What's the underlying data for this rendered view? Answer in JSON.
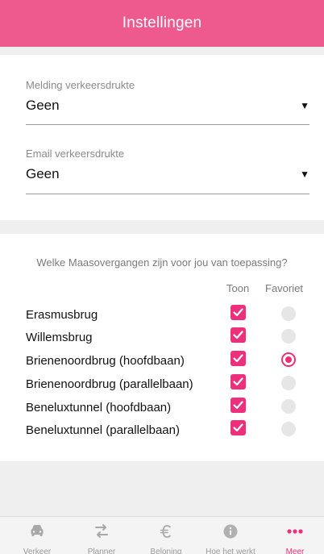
{
  "header": {
    "title": "Instellingen"
  },
  "notifications": {
    "melding": {
      "label": "Melding verkeersdrukte",
      "value": "Geen"
    },
    "email": {
      "label": "Email verkeersdrukte",
      "value": "Geen"
    }
  },
  "crossings": {
    "question": "Welke Maasovergangen zijn voor jou van toepassing?",
    "col_show": "Toon",
    "col_favorite": "Favoriet",
    "items": [
      {
        "label": "Erasmusbrug",
        "show": true,
        "favorite": false
      },
      {
        "label": "Willemsbrug",
        "show": true,
        "favorite": false
      },
      {
        "label": "Brienenoordbrug (hoofdbaan)",
        "show": true,
        "favorite": true
      },
      {
        "label": "Brienenoordbrug (parallelbaan)",
        "show": true,
        "favorite": false
      },
      {
        "label": "Beneluxtunnel (hoofdbaan)",
        "show": true,
        "favorite": false
      },
      {
        "label": "Beneluxtunnel (parallelbaan)",
        "show": true,
        "favorite": false
      }
    ]
  },
  "tabbar": {
    "tabs": [
      {
        "label": "Verkeer",
        "icon": "car-icon",
        "active": false
      },
      {
        "label": "Planner",
        "icon": "route-arrows-icon",
        "active": false
      },
      {
        "label": "Beloning",
        "icon": "euro-icon",
        "active": false
      },
      {
        "label": "Hoe het werkt",
        "icon": "info-icon",
        "active": false
      },
      {
        "label": "Meer",
        "icon": "more-dots-icon",
        "active": true
      }
    ]
  },
  "colors": {
    "accent": "#ee2f7b",
    "header": "#ef5a8e"
  }
}
